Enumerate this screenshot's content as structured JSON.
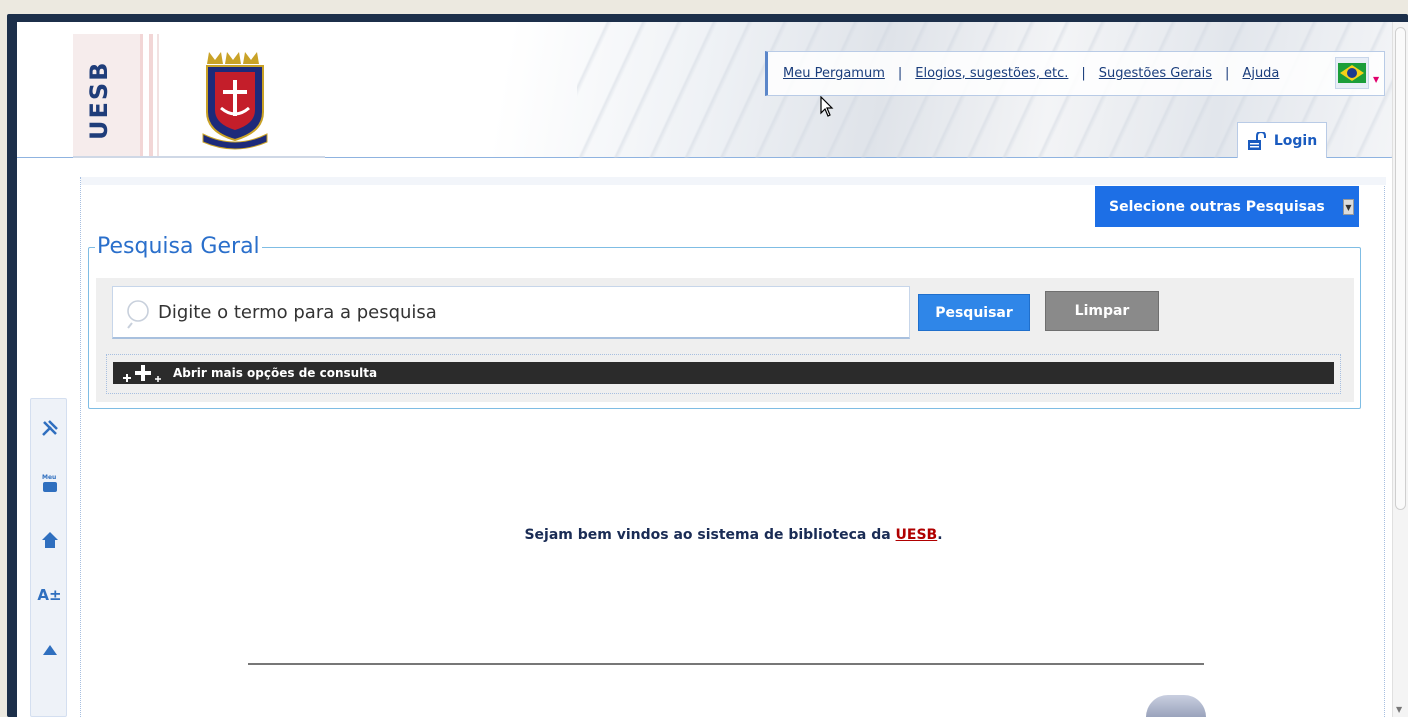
{
  "header": {
    "brand_vertical": "UESB",
    "links": [
      {
        "label": "Meu Pergamum"
      },
      {
        "label": "Elogios, sugestões, etc."
      },
      {
        "label": "Sugestões Gerais"
      },
      {
        "label": "Ajuda"
      }
    ],
    "separator": "|",
    "login_label": "Login",
    "language_flag": "brazil-flag-icon"
  },
  "search": {
    "select_other_label": "Selecione outras Pesquisas",
    "legend": "Pesquisa Geral",
    "placeholder": "Digite o termo para a pesquisa",
    "search_button": "Pesquisar",
    "clear_button": "Limpar",
    "more_options": "Abrir mais opções de consulta"
  },
  "left_tools": [
    {
      "icon": "tools-icon"
    },
    {
      "icon": "meu-icon",
      "label": "Meu"
    },
    {
      "icon": "home-icon"
    },
    {
      "icon": "font-size-icon",
      "label": "A±"
    },
    {
      "icon": "scroll-top-icon"
    }
  ],
  "welcome": {
    "text_before": "Sejam bem vindos ao sistema de biblioteca da ",
    "link": "UESB",
    "text_after": "."
  },
  "colors": {
    "frame": "#1c2f4a",
    "accent_blue": "#1d6fe6",
    "link_blue": "#1a3d7c",
    "welcome_link": "#b00000"
  }
}
